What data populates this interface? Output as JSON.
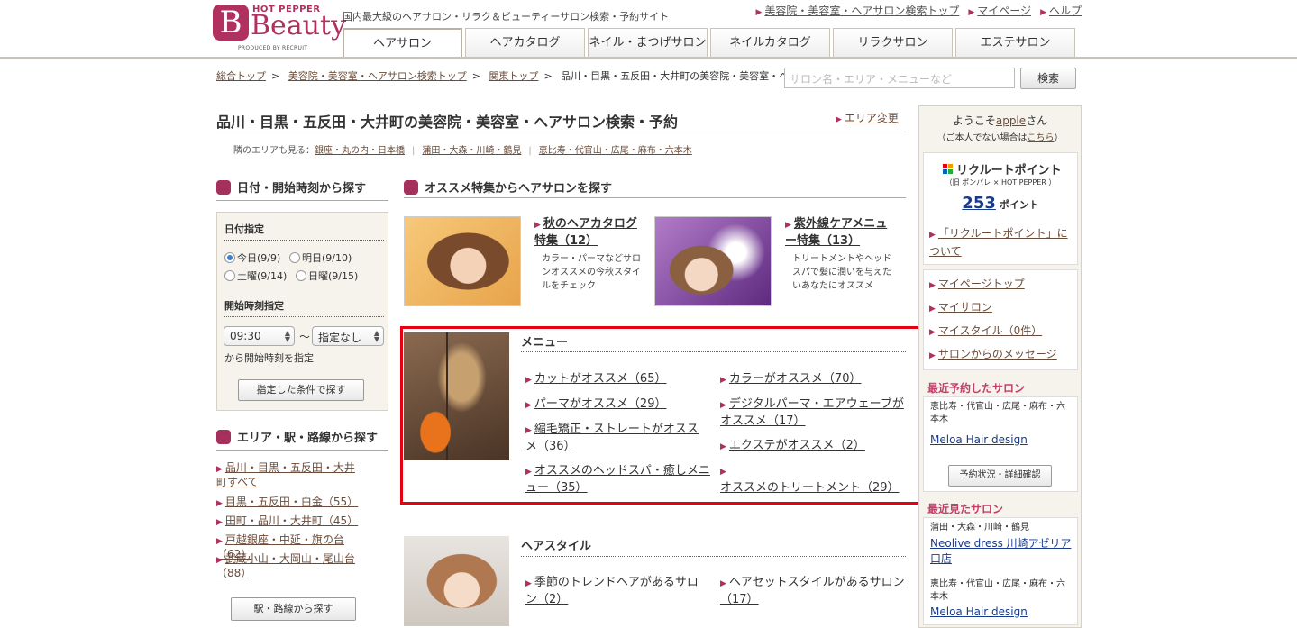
{
  "header": {
    "logo_top": "HOT PEPPER",
    "logo_main": "Beauty",
    "logo_sub": "PRODUCED BY RECRUIT",
    "tagline": "国内最大級のヘアサロン・リラク＆ビューティーサロン検索・予約サイト",
    "top_links": [
      "美容院・美容室・ヘアサロン検索トップ",
      "マイページ",
      "ヘルプ"
    ],
    "tabs": [
      "ヘアサロン",
      "ヘアカタログ",
      "ネイル・まつげサロン",
      "ネイルカタログ",
      "リラクサロン",
      "エステサロン"
    ],
    "active_tab": "ヘアサロン"
  },
  "breadcrumb": [
    "総合トップ",
    "美容院・美容室・ヘアサロン検索トップ",
    "関東トップ",
    "品川・目黒・五反田・大井町の美容院・美容室・ヘアサロン"
  ],
  "search": {
    "placeholder": "サロン名・エリア・メニューなど",
    "button": "検索"
  },
  "page": {
    "title": "品川・目黒・五反田・大井町の美容院・美容室・ヘアサロン検索・予約",
    "area_change": "エリア変更",
    "neighbor_label": "隣のエリアも見る：",
    "neighbors": [
      "銀座・丸の内・日本橋",
      "蒲田・大森・川崎・鶴見",
      "恵比寿・代官山・広尾・麻布・六本木"
    ]
  },
  "date_section": {
    "heading": "日付・開始時刻から探す",
    "date_label": "日付指定",
    "dates": [
      "今日(9/9)",
      "明日(9/10)",
      "土曜(9/14)",
      "日曜(9/15)"
    ],
    "selected_date": "今日(9/9)",
    "time_label": "開始時刻指定",
    "time_value": "09:30",
    "tilde": "〜",
    "end_value": "指定なし",
    "time_note": "から開始時刻を指定",
    "search_button": "指定した条件で探す"
  },
  "area_section": {
    "heading": "エリア・駅・路線から探す",
    "items": [
      "品川・目黒・五反田・大井町すべて",
      "目黒・五反田・白金（55）",
      "田町・品川・大井町（45）",
      "戸越銀座・中延・旗の台（62）",
      "武蔵小山・大岡山・尾山台（88）"
    ],
    "station_button": "駅・路線から探す"
  },
  "feature_section": {
    "heading": "オススメ特集からヘアサロンを探す",
    "features": [
      {
        "title": "秋のヘアカタログ特集（12）",
        "desc": "カラー・パーマなどサロンオススメの今秋スタイルをチェック"
      },
      {
        "title": "紫外線ケアメニュー特集（13）",
        "desc": "トリートメントやヘッドスパで髪に潤いを与えたいあなたにオススメ"
      }
    ]
  },
  "menu_section": {
    "heading": "メニュー",
    "left_links": [
      "カットがオススメ（65）",
      "パーマがオススメ（29）",
      "縮毛矯正・ストレートがオススメ（36）",
      "オススメのヘッドスパ・癒しメニュー（35）"
    ],
    "right_links": [
      "カラーがオススメ（70）",
      "デジタルパーマ・エアウェーブがオススメ（17）",
      "エクステがオススメ（2）",
      "オススメのトリートメント（29）"
    ]
  },
  "hairstyle_section": {
    "heading": "ヘアスタイル",
    "left_links": [
      "季節のトレンドヘアがあるサロン（2）"
    ],
    "right_links": [
      "ヘアセットスタイルがあるサロン（17）"
    ]
  },
  "sidebar": {
    "welcome_prefix": "ようこそ",
    "user": "apple",
    "welcome_suffix": "さん",
    "notyou_prefix": "（ご本人でない場合は",
    "notyou_link": "こちら",
    "notyou_suffix": "）",
    "points_title": "リクルートポイント",
    "points_old": "（旧 ポンパレ × HOT PEPPER ）",
    "points_value": "253",
    "points_unit": "ポイント",
    "points_about": "「リクルートポイント」について",
    "mypage_links": [
      "マイページトップ",
      "マイサロン",
      "マイスタイル（0件）",
      "サロンからのメッセージ"
    ],
    "recent_reserved_heading": "最近予約したサロン",
    "recent_reserved": {
      "area": "恵比寿・代官山・広尾・麻布・六本木",
      "name": "Meloa Hair design"
    },
    "reservation_button": "予約状況・詳細確認",
    "recent_viewed_heading": "最近見たサロン",
    "recent_viewed": [
      {
        "area": "蒲田・大森・川崎・鶴見",
        "name": "Neolive dress 川崎アゼリア口店"
      },
      {
        "area": "恵比寿・代官山・広尾・麻布・六本木",
        "name": "Meloa Hair design"
      }
    ]
  },
  "colors": {
    "brand": "#b0315f",
    "highlight": "#e50012",
    "link": "#6a4c3a"
  }
}
